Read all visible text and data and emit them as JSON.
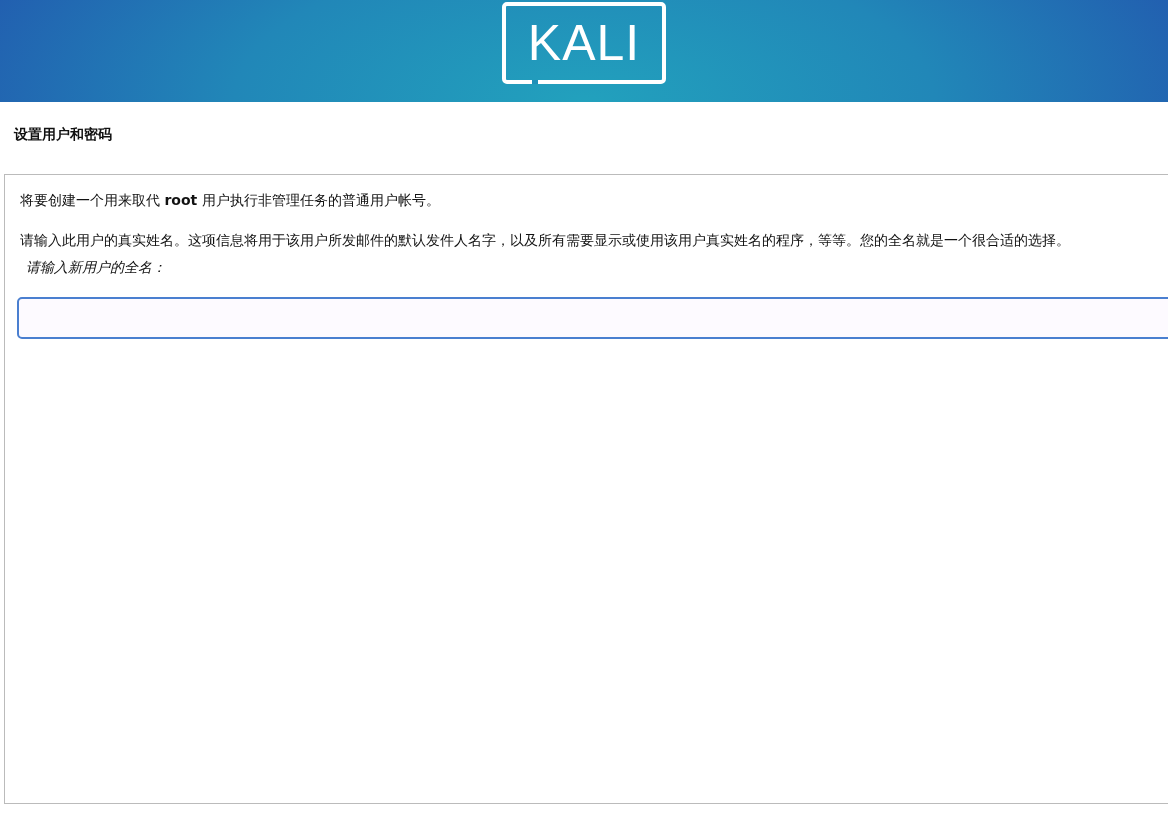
{
  "banner": {
    "logo": "KALI"
  },
  "title": "设置用户和密码",
  "paragraphs": [
    "将要创建一个用来取代 **root** 用户执行非管理任务的普通用户帐号。",
    "请输入此用户的真实姓名。这项信息将用于该用户所发邮件的默认发件人名字，以及所有需要显示或使用该用户真实姓名的程序，等等。您的全名就是一个很合适的选择。"
  ],
  "field": {
    "label": "请输入新用户的全名：",
    "focused": true
  }
}
